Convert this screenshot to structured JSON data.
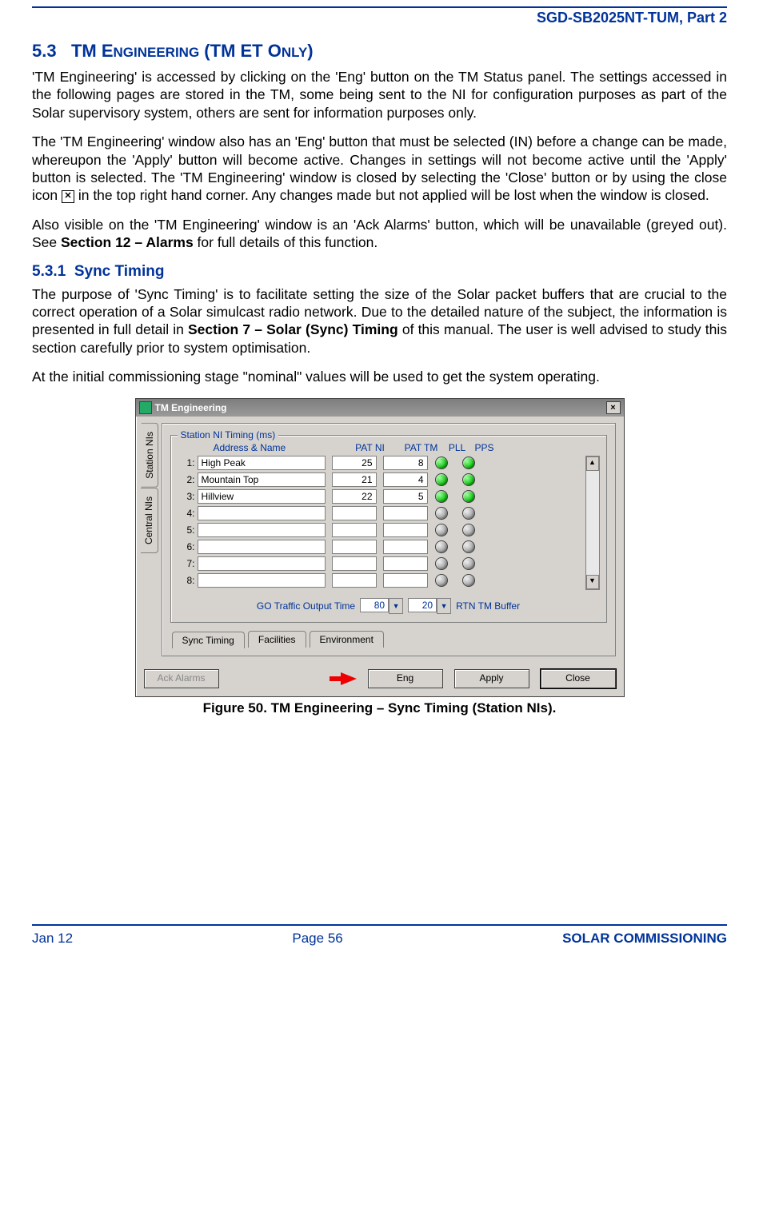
{
  "doc_header": "SGD-SB2025NT-TUM, Part 2",
  "section_num": "5.3",
  "section_title_caps": "TM Engineering (TM ET Only)",
  "p1": "'TM Engineering' is accessed by clicking on the 'Eng' button on the TM Status panel.  The settings accessed in the following pages are stored in the TM, some being sent to the NI for configuration purposes as part of the Solar supervisory system, others are sent for information purposes only.",
  "p2a": "The 'TM Engineering' window also has an 'Eng' button that must be selected (IN) before a change can be made, whereupon the 'Apply' button will become active.  Changes in settings will not become active until the 'Apply' button is selected.  The 'TM Engineering' window is closed by selecting the 'Close' button or by using the close icon ",
  "p2b": " in the top right hand corner.  Any changes made but not applied will be lost when the window is closed.",
  "p3a": "Also visible on the 'TM Engineering' window is an 'Ack Alarms' button, which will be unavailable (greyed out).  See ",
  "p3bold": "Section 12 – Alarms",
  "p3b": " for full details of this function.",
  "sub_num": "5.3.1",
  "sub_title": "Sync Timing",
  "p4a": "The purpose of 'Sync Timing' is to facilitate setting the size of the Solar packet buffers that are crucial to the correct operation of a Solar simulcast radio network.  Due to the detailed nature of the subject, the information is presented in full detail in ",
  "p4bold": "Section 7 – Solar (Sync) Timing",
  "p4b": " of this manual.  The user is well advised to study this section carefully prior to system optimisation.",
  "p5": "At the initial commissioning stage \"nominal\" values will be used to get the system operating.",
  "window": {
    "title": "TM Engineering",
    "close_x": "×",
    "vtabs": {
      "station": "Station NIs",
      "central": "Central NIs"
    },
    "group_legend": "Station NI Timing (ms)",
    "headers": {
      "addr": "Address & Name",
      "patni": "PAT NI",
      "pattm": "PAT TM",
      "pll": "PLL",
      "pps": "PPS"
    },
    "rows": [
      {
        "idx": "1:",
        "name": "High Peak",
        "patni": "25",
        "pattm": "8",
        "on": true
      },
      {
        "idx": "2:",
        "name": "Mountain Top",
        "patni": "21",
        "pattm": "4",
        "on": true
      },
      {
        "idx": "3:",
        "name": "Hillview",
        "patni": "22",
        "pattm": "5",
        "on": true
      },
      {
        "idx": "4:",
        "name": "",
        "patni": "",
        "pattm": "",
        "on": false
      },
      {
        "idx": "5:",
        "name": "",
        "patni": "",
        "pattm": "",
        "on": false
      },
      {
        "idx": "6:",
        "name": "",
        "patni": "",
        "pattm": "",
        "on": false
      },
      {
        "idx": "7:",
        "name": "",
        "patni": "",
        "pattm": "",
        "on": false
      },
      {
        "idx": "8:",
        "name": "",
        "patni": "",
        "pattm": "",
        "on": false
      }
    ],
    "scroll": {
      "up": "▲",
      "down": "▼"
    },
    "go_label": "GO Traffic Output Time",
    "go_value": "80",
    "rtn_value": "20",
    "rtn_label": "RTN TM Buffer",
    "combo_arrow": "▼",
    "htabs": {
      "sync": "Sync Timing",
      "fac": "Facilities",
      "env": "Environment"
    },
    "buttons": {
      "ack": "Ack Alarms",
      "eng": "Eng",
      "apply": "Apply",
      "close": "Close"
    }
  },
  "caption": "Figure 50.  TM Engineering – Sync Timing (Station NIs).",
  "footer": {
    "left": "Jan 12",
    "center": "Page 56",
    "right": "SOLAR COMMISSIONING"
  }
}
